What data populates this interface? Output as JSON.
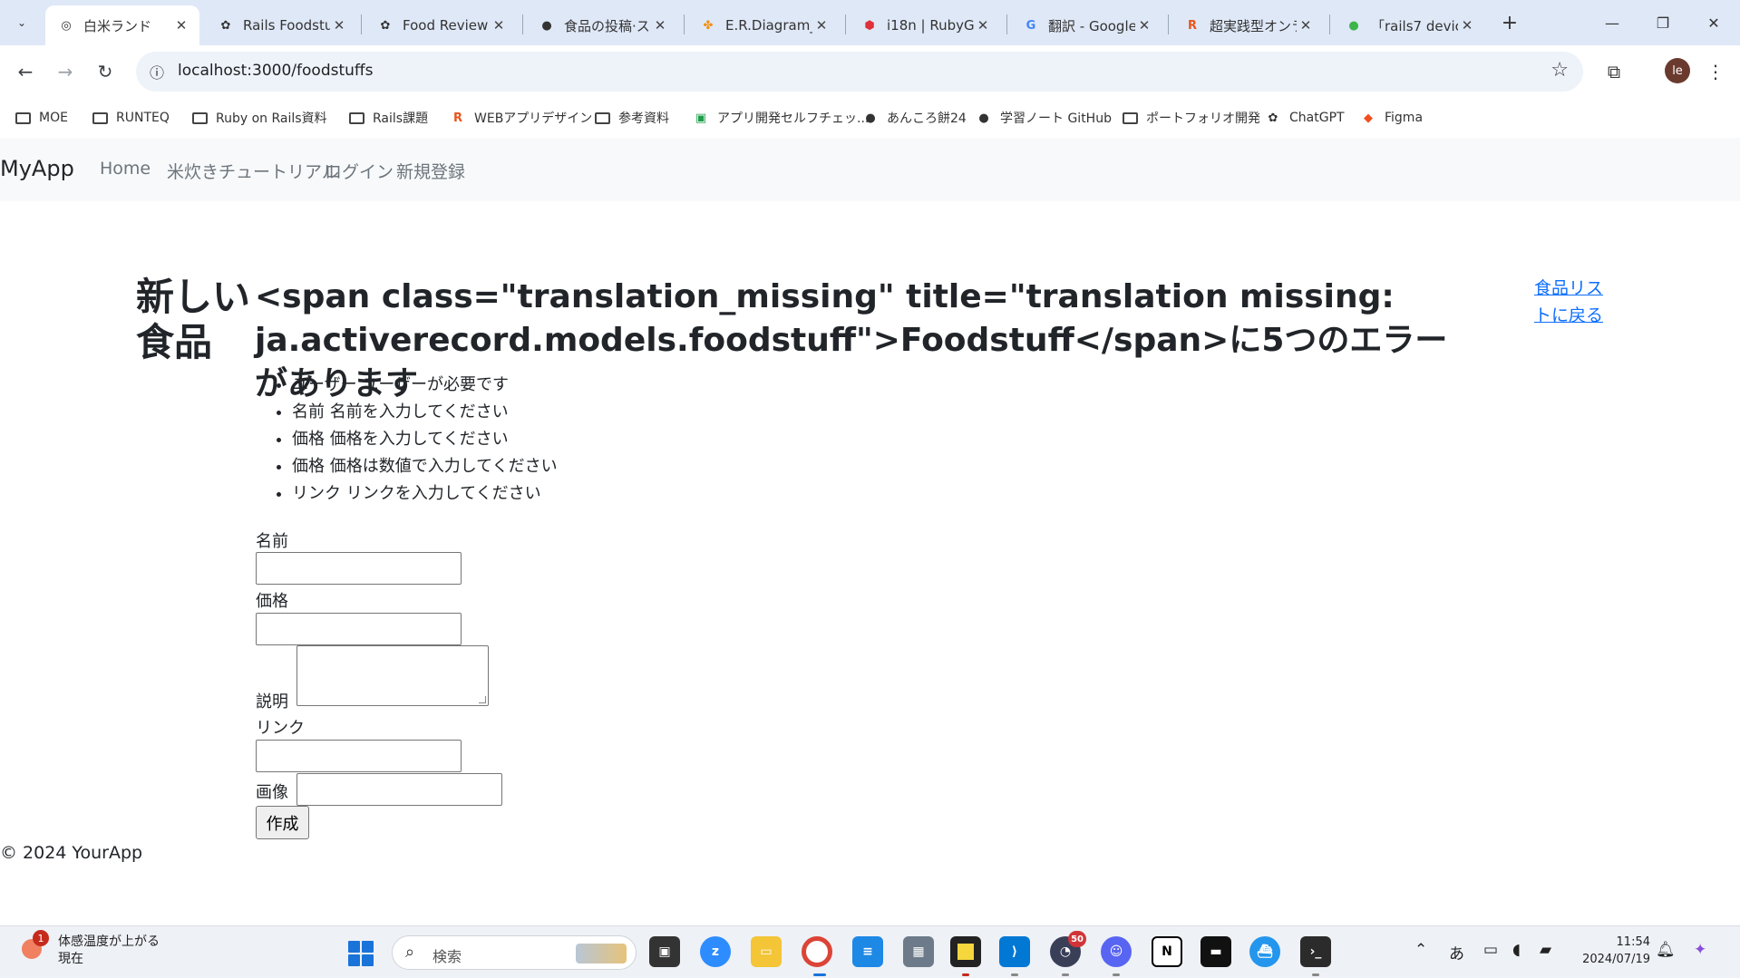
{
  "browser": {
    "tabs": [
      {
        "title": "白米ランド",
        "icon": "globe-icon",
        "active": true
      },
      {
        "title": "Rails Foodstu",
        "icon": "chatgpt-icon",
        "active": false
      },
      {
        "title": "Food Review",
        "icon": "chatgpt-icon",
        "active": false
      },
      {
        "title": "食品の投稿·ス",
        "icon": "github-icon",
        "active": false
      },
      {
        "title": "E.R.Diagram_",
        "icon": "er-diagram-icon",
        "active": false
      },
      {
        "title": "i18n | RubyGe",
        "icon": "rubygems-icon",
        "active": false
      },
      {
        "title": "翻訳 - Google",
        "icon": "google-icon",
        "active": false
      },
      {
        "title": "超実践型オンラ",
        "icon": "runteq-icon",
        "active": false
      },
      {
        "title": "「rails7 device",
        "icon": "green-circle-icon",
        "active": false
      }
    ],
    "close_glyph": "✕",
    "new_tab_glyph": "+",
    "url": "localhost:3000/foodstuffs",
    "profile_initial": "le",
    "bookmarks": [
      {
        "label": "MOE",
        "icon": "folder-icon"
      },
      {
        "label": "RUNTEQ",
        "icon": "folder-icon"
      },
      {
        "label": "Ruby on Rails資料",
        "icon": "folder-icon"
      },
      {
        "label": "Rails課題",
        "icon": "folder-icon"
      },
      {
        "label": "WEBアプリデザイン",
        "icon": "runteq-icon"
      },
      {
        "label": "参考資料",
        "icon": "folder-icon"
      },
      {
        "label": "アプリ開発セルフチェッ...",
        "icon": "sheets-icon"
      },
      {
        "label": "あんころ餅24",
        "icon": "github-icon"
      },
      {
        "label": "学習ノート GitHub",
        "icon": "github-icon"
      },
      {
        "label": "ポートフォリオ開発",
        "icon": "folder-icon"
      },
      {
        "label": "ChatGPT",
        "icon": "chatgpt-icon"
      },
      {
        "label": "Figma",
        "icon": "figma-icon"
      }
    ]
  },
  "app": {
    "brand": "MyApp",
    "nav": [
      "Home",
      "米炊きチュートリアル",
      "ログイン",
      "新規登録"
    ],
    "page_title": "新しい食品",
    "error_heading": "<span class=\"translation_missing\" title=\"translation missing: ja.activerecord.models.foodstuff\">Foodstuff</span>に5つのエラーがあります",
    "errors": [
      "ユーザー ユーザーが必要です",
      "名前 名前を入力してください",
      "価格 価格を入力してください",
      "価格 価格は数値で入力してください",
      "リンク リンクを入力してください"
    ],
    "back_link": "食品リストに戻る",
    "form": {
      "name_label": "名前",
      "price_label": "価格",
      "description_label": "説明",
      "link_label": "リンク",
      "image_label": "画像",
      "submit_label": "作成"
    },
    "footer": "© 2024 YourApp",
    "link_color": "#0d6efd"
  },
  "taskbar": {
    "weather_title": "体感温度が上がる",
    "weather_sub": "現在",
    "weather_badge": "1",
    "search_placeholder": "検索",
    "apps": [
      {
        "name": "task-view-icon",
        "badge": ""
      },
      {
        "name": "zoom-icon",
        "badge": ""
      },
      {
        "name": "file-explorer-icon",
        "badge": ""
      },
      {
        "name": "chrome-icon",
        "badge": ""
      },
      {
        "name": "notepad-icon",
        "badge": ""
      },
      {
        "name": "calculator-icon",
        "badge": ""
      },
      {
        "name": "sticky-notes-icon",
        "badge": ""
      },
      {
        "name": "vscode-icon",
        "badge": ""
      },
      {
        "name": "runcat-icon",
        "badge": "50"
      },
      {
        "name": "discord-icon",
        "badge": ""
      },
      {
        "name": "notion-icon",
        "badge": ""
      },
      {
        "name": "terminal-icon",
        "badge": ""
      },
      {
        "name": "docker-icon",
        "badge": ""
      },
      {
        "name": "windows-terminal-icon",
        "badge": ""
      }
    ],
    "ime": "あ",
    "time": "11:54",
    "date": "2024/07/19"
  }
}
